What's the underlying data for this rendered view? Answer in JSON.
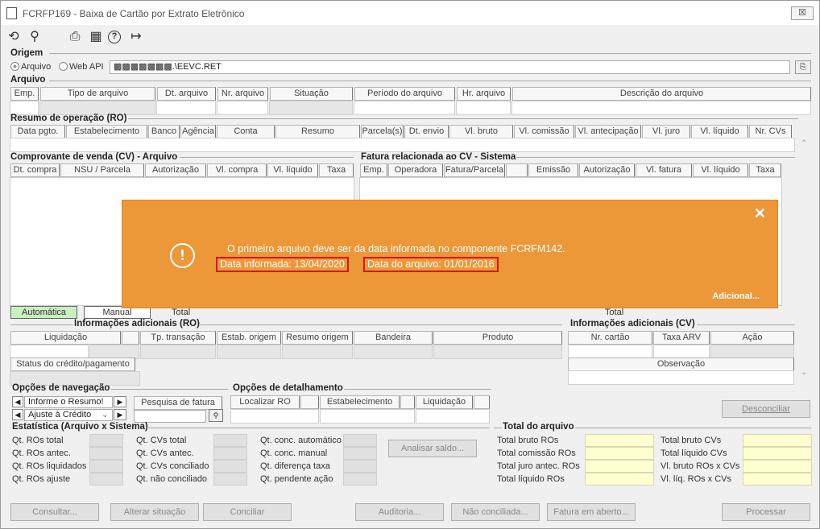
{
  "window": {
    "title": "FCRFP169 - Baixa de Cartão por Extrato Eletrônico",
    "close": "☒"
  },
  "toolbar": {
    "undo": "⟲",
    "search": "⚲",
    "print": "⎙",
    "calendar": "▦",
    "help": "?",
    "exit": "↦"
  },
  "origem": {
    "title": "Origem",
    "opt1": "Arquivo",
    "opt2": "Web API",
    "path": "▩▩▩▩▩▩▩.\\EEVC.RET"
  },
  "arquivo": {
    "title": "Arquivo",
    "cols": [
      "Emp.",
      "Tipo de arquivo",
      "Dt. arquivo",
      "Nr. arquivo",
      "Situação",
      "Período do arquivo",
      "Hr. arquivo",
      "Descrição do arquivo"
    ]
  },
  "resumo": {
    "title": "Resumo de operação (RO)",
    "cols": [
      "Data pgto.",
      "Estabelecimento",
      "Banco",
      "Agência",
      "Conta",
      "Resumo",
      "Parcela(s)",
      "Dt. envio",
      "Vl. bruto",
      "Vl. comissão",
      "Vl. antecipação",
      "Vl. juro",
      "Vl. líquido",
      "Nr. CVs"
    ]
  },
  "comprovante": {
    "title": "Comprovante de venda (CV) - Arquivo",
    "cols": [
      "Dt. compra",
      "NSU / Parcela",
      "Autorização",
      "Vl. compra",
      "Vl. líquido",
      "Taxa"
    ]
  },
  "fatura": {
    "title": "Fatura relacionada ao CV - Sistema",
    "cols": [
      "Emp.",
      "Operadora",
      "Fatura/Parcela",
      "",
      "Emissão",
      "Autorização",
      "Vl. fatura",
      "Vl. líquido",
      "Taxa"
    ]
  },
  "modes": {
    "auto": "Automática",
    "manual": "Manual",
    "total": "Total",
    "total2": "Total"
  },
  "infoRO": {
    "title": "Informações adicionais (RO)",
    "cols": [
      "Liquidação",
      "",
      "Tp. transação",
      "Estab. origem",
      "Resumo origem",
      "Bandeira",
      "Produto"
    ],
    "status": "Status do crédito/pagamento"
  },
  "infoCV": {
    "title": "Informações adicionais (CV)",
    "cols": [
      "Nr. cartão",
      "Taxa ARV",
      "Ação"
    ],
    "obs": "Observação"
  },
  "nav": {
    "title": "Opções de navegação",
    "sel1": "Informe o Resumo!",
    "sel2": "Ajuste à Crédito",
    "pesquisa": "Pesquisa de fatura"
  },
  "detalhe": {
    "title": "Opções de detalhamento",
    "cols": [
      "Localizar RO",
      "",
      "Estabelecimento",
      "",
      "Liquidação",
      ""
    ]
  },
  "desconciliar": "Desconciliar",
  "estat": {
    "title": "Estatística (Arquivo x Sistema)",
    "c1": [
      "Qt. ROs total",
      "Qt. ROs antec.",
      "Qt. ROs liquidados",
      "Qt. ROs ajuste"
    ],
    "c2": [
      "Qt. CVs total",
      "Qt. CVs antec.",
      "Qt. CVs conciliado",
      "Qt. não conciliado"
    ],
    "c3": [
      "Qt. conc. automático",
      "Qt. conc. manual",
      "Qt. diferença taxa",
      "Qt. pendente ação"
    ],
    "analisar": "Analisar saldo..."
  },
  "totalArq": {
    "title": "Total do arquivo",
    "c1": [
      "Total bruto ROs",
      "Total comissão ROs",
      "Total juro antec. ROs",
      "Total líquido ROs"
    ],
    "c2": [
      "Total bruto CVs",
      "Total líquido CVs",
      "Vl. bruto ROs x CVs",
      "Vl. líq. ROs x CVs"
    ]
  },
  "buttons": [
    "Consultar...",
    "Alterar situação",
    "Conciliar",
    "Auditoria...",
    "Não conciliada...",
    "Fatura em aberto...",
    "Processar"
  ],
  "toast": {
    "line1": "O primeiro arquivo deve ser da data informada no componente FCRFM142.",
    "date1": "Data informada: 13/04/2020",
    "date2": "Data do arquivo: 01/01/2016",
    "more": "Adicional...",
    "close": "✕",
    "icon": "!"
  }
}
